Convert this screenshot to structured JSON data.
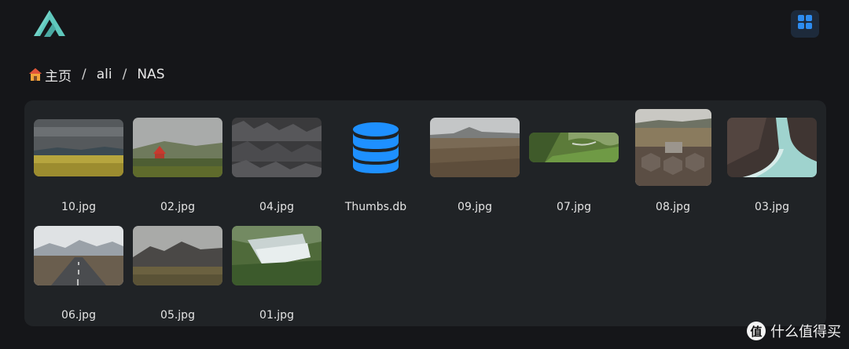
{
  "breadcrumb": {
    "items": [
      "主页",
      "ali",
      "NAS"
    ],
    "separator": "/"
  },
  "view_toggle": {
    "icon": "grid-icon"
  },
  "accent_color": "#1e90ff",
  "files": [
    {
      "name": "10.jpg",
      "kind": "image"
    },
    {
      "name": "02.jpg",
      "kind": "image"
    },
    {
      "name": "04.jpg",
      "kind": "image"
    },
    {
      "name": "Thumbs.db",
      "kind": "database",
      "icon": "database-icon"
    },
    {
      "name": "09.jpg",
      "kind": "image"
    },
    {
      "name": "07.jpg",
      "kind": "image"
    },
    {
      "name": "08.jpg",
      "kind": "image"
    },
    {
      "name": "03.jpg",
      "kind": "image"
    },
    {
      "name": "06.jpg",
      "kind": "image"
    },
    {
      "name": "05.jpg",
      "kind": "image"
    },
    {
      "name": "01.jpg",
      "kind": "image"
    }
  ],
  "watermark": {
    "text": "什么值得买",
    "badge": "值"
  }
}
